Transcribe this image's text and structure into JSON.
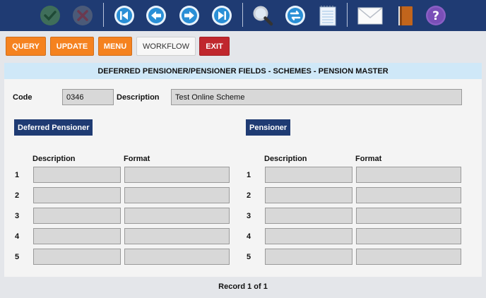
{
  "toolbar": {
    "icons": [
      "accept-icon",
      "cancel-icon",
      "first-record-icon",
      "previous-record-icon",
      "next-record-icon",
      "last-record-icon",
      "search-icon",
      "refresh-icon",
      "notes-icon",
      "mail-icon",
      "book-icon",
      "help-icon"
    ]
  },
  "actions": {
    "query": "QUERY",
    "update": "UPDATE",
    "menu": "MENU",
    "workflow": "WORKFLOW",
    "exit": "EXIT"
  },
  "panel": {
    "title": "DEFERRED PENSIONER/PENSIONER FIELDS - SCHEMES - PENSION MASTER",
    "code_label": "Code",
    "code_value": "0346",
    "description_label": "Description",
    "description_value": "Test Online Scheme"
  },
  "deferred": {
    "heading": "Deferred Pensioner",
    "col_description": "Description",
    "col_format": "Format",
    "rows": [
      {
        "num": "1",
        "description": "",
        "format": ""
      },
      {
        "num": "2",
        "description": "",
        "format": ""
      },
      {
        "num": "3",
        "description": "",
        "format": ""
      },
      {
        "num": "4",
        "description": "",
        "format": ""
      },
      {
        "num": "5",
        "description": "",
        "format": ""
      }
    ]
  },
  "pensioner": {
    "heading": "Pensioner",
    "col_description": "Description",
    "col_format": "Format",
    "rows": [
      {
        "num": "1",
        "description": "",
        "format": ""
      },
      {
        "num": "2",
        "description": "",
        "format": ""
      },
      {
        "num": "3",
        "description": "",
        "format": ""
      },
      {
        "num": "4",
        "description": "",
        "format": ""
      },
      {
        "num": "5",
        "description": "",
        "format": ""
      }
    ]
  },
  "footer": {
    "record_status": "Record 1 of 1"
  }
}
